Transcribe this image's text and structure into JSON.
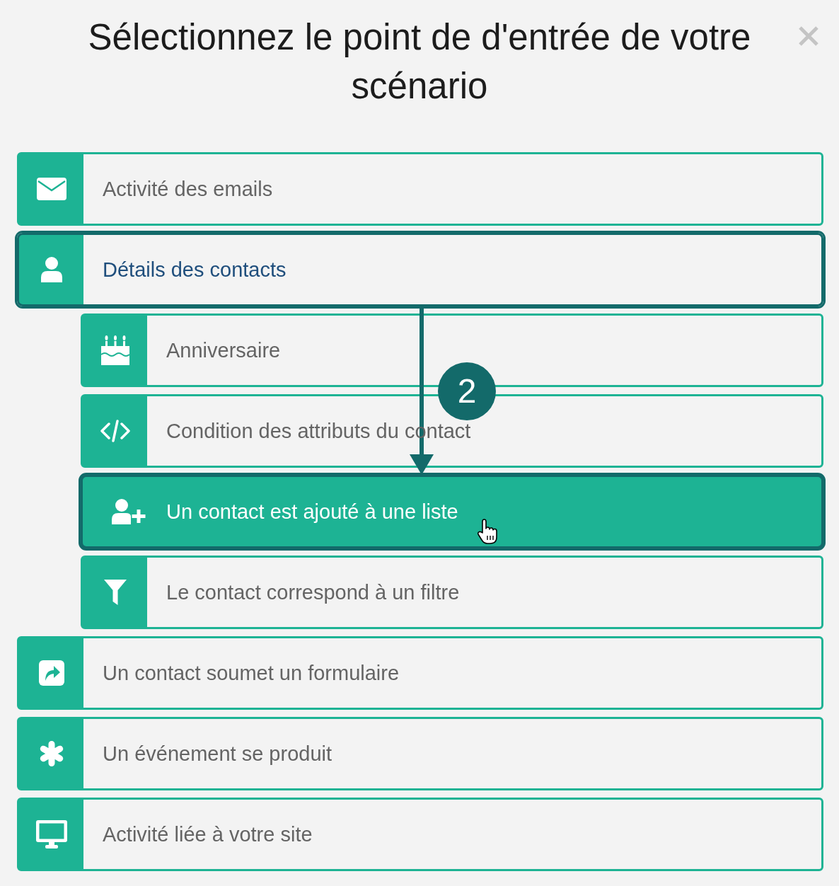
{
  "dialog": {
    "title": "Sélectionnez le point de d'entrée de votre scénario"
  },
  "entry_points": [
    {
      "label": "Activité des emails",
      "expanded": false,
      "highlighted": false,
      "selected": false
    },
    {
      "label": "Détails des contacts",
      "expanded": true,
      "highlighted": true,
      "selected": false,
      "children": [
        {
          "label": "Anniversaire",
          "highlighted": false,
          "selected": false
        },
        {
          "label": "Condition des attributs du contact",
          "highlighted": false,
          "selected": false
        },
        {
          "label": "Un contact est ajouté à une liste",
          "highlighted": true,
          "selected": true
        },
        {
          "label": "Le contact correspond à un filtre",
          "highlighted": false,
          "selected": false
        }
      ]
    },
    {
      "label": "Un contact soumet un formulaire",
      "expanded": false,
      "highlighted": false,
      "selected": false
    },
    {
      "label": "Un événement se produit",
      "expanded": false,
      "highlighted": false,
      "selected": false
    },
    {
      "label": "Activité liée à votre site",
      "expanded": false,
      "highlighted": false,
      "selected": false
    }
  ],
  "annotation": {
    "step_number": "2"
  }
}
